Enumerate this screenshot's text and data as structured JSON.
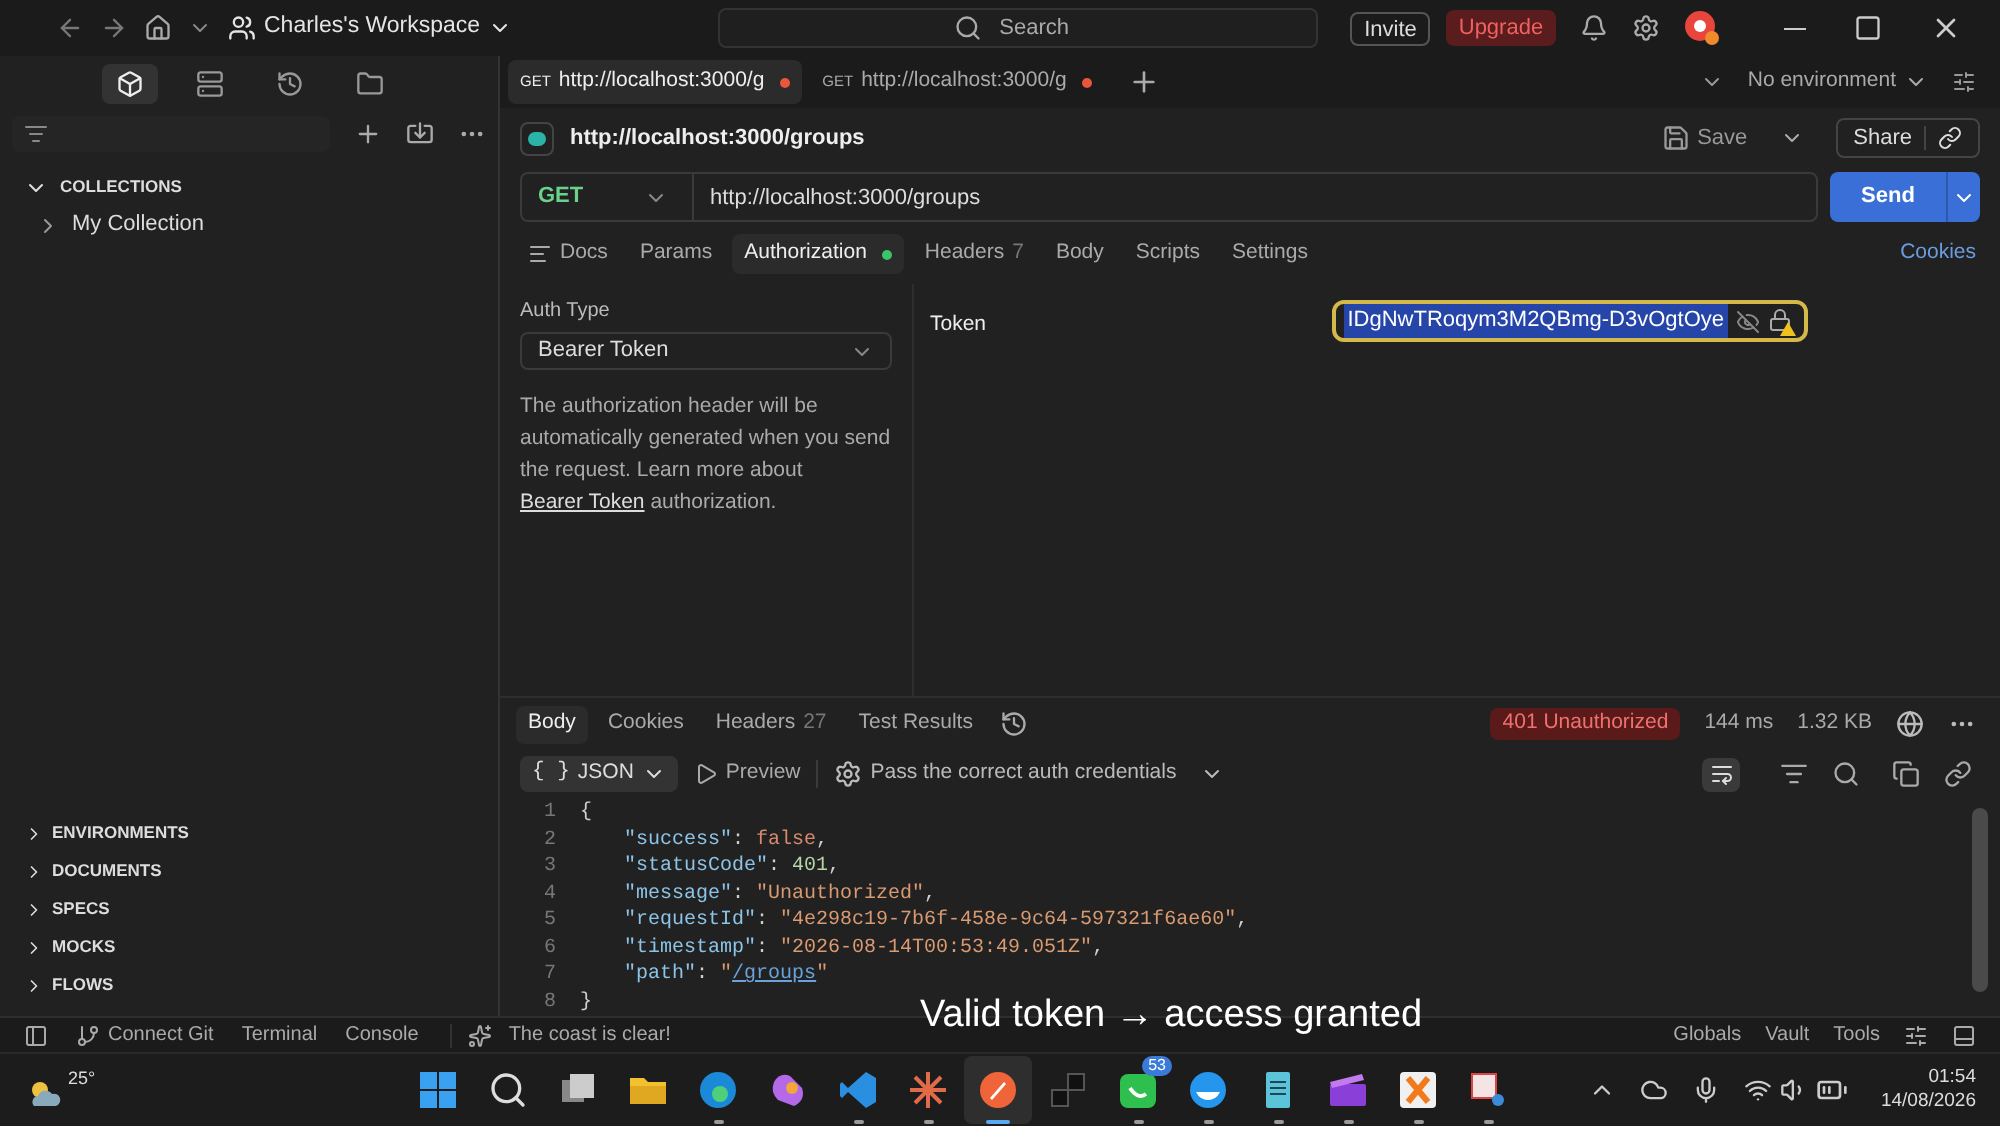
{
  "window": {
    "workspace": "Charles's Workspace",
    "search_placeholder": "Search",
    "invite": "Invite",
    "upgrade": "Upgrade"
  },
  "request_tabs": [
    {
      "method": "GET",
      "url": "http://localhost:3000/g",
      "selected": true
    },
    {
      "method": "GET",
      "url": "http://localhost:3000/g",
      "selected": false
    }
  ],
  "environment": "No environment",
  "sidebar": {
    "views": [
      {
        "kind": "cube",
        "selected": true
      },
      {
        "kind": "server",
        "selected": false
      },
      {
        "kind": "history",
        "selected": false
      },
      {
        "kind": "folder",
        "selected": false
      }
    ],
    "collections": {
      "title": "COLLECTIONS",
      "expanded": true,
      "items": [
        {
          "label": "My Collection",
          "expanded": false
        }
      ]
    },
    "sections": [
      {
        "label": "ENVIRONMENTS",
        "expanded": false
      },
      {
        "label": "DOCUMENTS",
        "expanded": false
      },
      {
        "label": "SPECS",
        "expanded": false
      },
      {
        "label": "MOCKS",
        "expanded": false
      },
      {
        "label": "FLOWS",
        "expanded": false
      }
    ]
  },
  "request": {
    "title": "http://localhost:3000/groups",
    "save": "Save",
    "share": "Share",
    "method": "GET",
    "url": "http://localhost:3000/groups",
    "send": "Send",
    "cookies": "Cookies",
    "tabs": [
      {
        "label": "Docs",
        "selected": false
      },
      {
        "label": "Params",
        "selected": false
      },
      {
        "label": "Authorization",
        "selected": true,
        "dot": true
      },
      {
        "label": "Headers",
        "count": "7",
        "selected": false
      },
      {
        "label": "Body",
        "selected": false
      },
      {
        "label": "Scripts",
        "selected": false
      },
      {
        "label": "Settings",
        "selected": false
      }
    ]
  },
  "auth": {
    "type_label": "Auth Type",
    "type": "Bearer Token",
    "help": "The authorization header will be automatically generated when you send the request. Learn more about",
    "link": "Bearer Token",
    "help_end": "authorization.",
    "token_label": "Token",
    "token": "IDgNwTRoqym3M2QBmg-D3vOgtOye",
    "token_selected": true
  },
  "response": {
    "tabs": [
      {
        "label": "Body",
        "selected": true
      },
      {
        "label": "Cookies",
        "selected": false
      },
      {
        "label": "Headers",
        "count": "27",
        "selected": false
      },
      {
        "label": "Test Results",
        "selected": false
      }
    ],
    "status": "401 Unauthorized",
    "time": "144 ms",
    "size": "1.32 KB",
    "format_icon": "{ }",
    "format": "JSON",
    "preview": "Preview",
    "hint": "Pass the correct auth credentials",
    "lines": [
      {
        "number": "1",
        "tokens": [
          {
            "kind": "punct",
            "text": "{"
          }
        ],
        "children": [
          {
            "number": "2",
            "tokens": [
              {
                "kind": "key",
                "text": "\"success\""
              },
              {
                "kind": "punct",
                "text": ": "
              },
              {
                "kind": "bool",
                "text": "false"
              },
              {
                "kind": "punct",
                "text": ","
              }
            ]
          },
          {
            "number": "3",
            "tokens": [
              {
                "kind": "key",
                "text": "\"statusCode\""
              },
              {
                "kind": "punct",
                "text": ": "
              },
              {
                "kind": "number",
                "text": "401"
              },
              {
                "kind": "punct",
                "text": ","
              }
            ]
          },
          {
            "number": "4",
            "tokens": [
              {
                "kind": "key",
                "text": "\"message\""
              },
              {
                "kind": "punct",
                "text": ": "
              },
              {
                "kind": "string",
                "text": "\"Unauthorized\""
              },
              {
                "kind": "punct",
                "text": ","
              }
            ]
          },
          {
            "number": "5",
            "tokens": [
              {
                "kind": "key",
                "text": "\"requestId\""
              },
              {
                "kind": "punct",
                "text": ": "
              },
              {
                "kind": "string",
                "text": "\"4e298c19-7b6f-458e-9c64-597321f6ae60\""
              },
              {
                "kind": "punct",
                "text": ","
              }
            ]
          },
          {
            "number": "6",
            "tokens": [
              {
                "kind": "key",
                "text": "\"timestamp\""
              },
              {
                "kind": "punct",
                "text": ": "
              },
              {
                "kind": "string",
                "text": "\"2026-08-14T00:53:49.051Z\""
              },
              {
                "kind": "punct",
                "text": ","
              }
            ]
          },
          {
            "number": "7",
            "tokens": [
              {
                "kind": "key",
                "text": "\"path\""
              },
              {
                "kind": "punct",
                "text": ": "
              },
              {
                "kind": "string",
                "text": "\""
              },
              {
                "kind": "link",
                "text": "/groups"
              },
              {
                "kind": "string",
                "text": "\""
              }
            ]
          }
        ]
      },
      {
        "number": "8",
        "tokens": [
          {
            "kind": "punct",
            "text": "}"
          }
        ]
      }
    ]
  },
  "status_bar": {
    "left": [
      "Connect Git",
      "Terminal",
      "Console"
    ],
    "message": "The coast is clear!",
    "right": [
      "Globals",
      "Vault",
      "Tools"
    ]
  },
  "caption": "Valid token → access granted",
  "taskbar": {
    "weather": "25°",
    "time": "01:54",
    "date": "14/08/2026",
    "apps": [
      {
        "kind": "start",
        "running": false,
        "active": false
      },
      {
        "kind": "search",
        "running": false,
        "active": false
      },
      {
        "kind": "taskview",
        "running": false,
        "active": false
      },
      {
        "kind": "folder",
        "running": false,
        "active": false
      },
      {
        "kind": "edge",
        "running": true,
        "active": false
      },
      {
        "kind": "copilot",
        "running": false,
        "active": false
      },
      {
        "kind": "code",
        "running": true,
        "active": false
      },
      {
        "kind": "star",
        "running": true,
        "active": false
      },
      {
        "kind": "rocket",
        "running": true,
        "active": true
      },
      {
        "kind": "blocks",
        "running": false,
        "active": false
      },
      {
        "kind": "chat",
        "running": true,
        "active": false,
        "badge": "53"
      },
      {
        "kind": "whale",
        "running": true,
        "active": false
      },
      {
        "kind": "notepad",
        "running": true,
        "active": false
      },
      {
        "kind": "clapper",
        "running": true,
        "active": false
      },
      {
        "kind": "xbox",
        "running": true,
        "active": false
      },
      {
        "kind": "snip",
        "running": true,
        "active": false
      }
    ]
  }
}
